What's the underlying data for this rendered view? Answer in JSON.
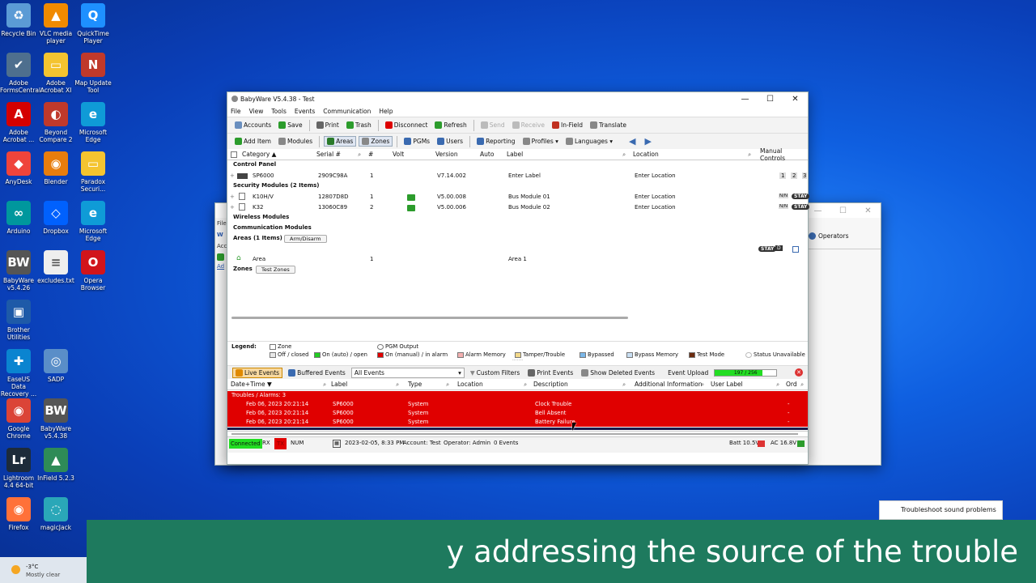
{
  "desktop": {
    "icons": [
      {
        "label": "Recycle Bin",
        "col": 0,
        "row": 0,
        "color": "#5b9bd5",
        "glyph": "♻"
      },
      {
        "label": "VLC media player",
        "col": 1,
        "row": 0,
        "color": "#f08a00",
        "glyph": "▲"
      },
      {
        "label": "QuickTime Player",
        "col": 2,
        "row": 0,
        "color": "#1e90ff",
        "glyph": "Q"
      },
      {
        "label": "Adobe FormsCentral",
        "col": 0,
        "row": 1,
        "color": "#4e6f8e",
        "glyph": "✔"
      },
      {
        "label": "Adobe Acrobat XI",
        "col": 1,
        "row": 1,
        "color": "#f4c430",
        "glyph": "▭"
      },
      {
        "label": "Map Update Tool",
        "col": 2,
        "row": 1,
        "color": "#c0392b",
        "glyph": "N"
      },
      {
        "label": "Adobe Acrobat ...",
        "col": 0,
        "row": 2,
        "color": "#d40000",
        "glyph": "A"
      },
      {
        "label": "Beyond Compare 2",
        "col": 1,
        "row": 2,
        "color": "#c0392b",
        "glyph": "◐"
      },
      {
        "label": "Microsoft Edge",
        "col": 2,
        "row": 2,
        "color": "#0f9bd7",
        "glyph": "e"
      },
      {
        "label": "AnyDesk",
        "col": 0,
        "row": 3,
        "color": "#ef443b",
        "glyph": "◆"
      },
      {
        "label": "Blender",
        "col": 1,
        "row": 3,
        "color": "#e87d0d",
        "glyph": "◉"
      },
      {
        "label": "Paradox Securi...",
        "col": 2,
        "row": 3,
        "color": "#f4c430",
        "glyph": "▭"
      },
      {
        "label": "Arduino",
        "col": 0,
        "row": 4,
        "color": "#00979d",
        "glyph": "∞"
      },
      {
        "label": "Dropbox",
        "col": 1,
        "row": 4,
        "color": "#0061fe",
        "glyph": "◇"
      },
      {
        "label": "Microsoft Edge",
        "col": 2,
        "row": 4,
        "color": "#0f9bd7",
        "glyph": "e"
      },
      {
        "label": "BabyWare v5.4.26",
        "col": 0,
        "row": 5,
        "color": "#555",
        "glyph": "BW"
      },
      {
        "label": "excludes.txt",
        "col": 1,
        "row": 5,
        "color": "#eee",
        "glyph": "≡"
      },
      {
        "label": "Opera Browser",
        "col": 2,
        "row": 5,
        "color": "#d1141b",
        "glyph": "O"
      },
      {
        "label": "Brother Utilities",
        "col": 0,
        "row": 6,
        "color": "#1e5aa8",
        "glyph": "▣"
      },
      {
        "label": "EaseUS Data Recovery ...",
        "col": 0,
        "row": 7,
        "color": "#0a84d0",
        "glyph": "✚"
      },
      {
        "label": "SADP",
        "col": 1,
        "row": 7,
        "color": "#5a8ec8",
        "glyph": "◎"
      },
      {
        "label": "Google Chrome",
        "col": 0,
        "row": 8,
        "color": "#db4437",
        "glyph": "◉"
      },
      {
        "label": "BabyWare v5.4.38",
        "col": 1,
        "row": 8,
        "color": "#555",
        "glyph": "BW"
      },
      {
        "label": "Lightroom 4.4 64-bit",
        "col": 0,
        "row": 9,
        "color": "#1d2b3a",
        "glyph": "Lr"
      },
      {
        "label": "InField 5.2.3",
        "col": 1,
        "row": 9,
        "color": "#2e8b57",
        "glyph": "▲"
      },
      {
        "label": "Firefox",
        "col": 0,
        "row": 10,
        "color": "#ff7139",
        "glyph": "◉"
      },
      {
        "label": "magicJack",
        "col": 1,
        "row": 10,
        "color": "#2aa7b8",
        "glyph": "◌"
      }
    ]
  },
  "weather": {
    "temp": "-3°C",
    "cond": "Mostly clear"
  },
  "tooltip": "Troubleshoot sound problems",
  "caption": "y addressing the source of the trouble",
  "bgwin": {
    "toolbar_item": "Operators",
    "sidebar": [
      "File",
      "W",
      "Acc",
      "Ad"
    ]
  },
  "app": {
    "title": "BabyWare V5.4.38 - Test",
    "menu": [
      "File",
      "View",
      "Tools",
      "Events",
      "Communication",
      "Help"
    ],
    "toolbar1": [
      {
        "label": "Accounts",
        "color": "#6a8fbf"
      },
      {
        "label": "Save",
        "color": "#2c9c2c"
      },
      {
        "label": "Print",
        "color": "#666"
      },
      {
        "label": "Trash",
        "color": "#2c9c2c"
      },
      {
        "label": "Disconnect",
        "color": "#d00"
      },
      {
        "label": "Refresh",
        "color": "#2c9c2c"
      },
      {
        "label": "Send",
        "color": "#bbb",
        "dis": true
      },
      {
        "label": "Receive",
        "color": "#bbb",
        "dis": true
      },
      {
        "label": "In-Field",
        "color": "#c03020"
      },
      {
        "label": "Translate",
        "color": "#888"
      }
    ],
    "toolbar2": [
      {
        "label": "Add Item",
        "color": "#2c9c2c"
      },
      {
        "label": "Modules",
        "color": "#888"
      },
      {
        "label": "Areas",
        "color": "#2a7a2a",
        "sel": true
      },
      {
        "label": "Zones",
        "color": "#888",
        "sel": true
      },
      {
        "label": "PGMs",
        "color": "#3a6ab0"
      },
      {
        "label": "Users",
        "color": "#3a6ab0"
      },
      {
        "label": "Reporting",
        "color": "#3a6ab0"
      },
      {
        "label": "Profiles ▾",
        "color": "#888"
      },
      {
        "label": "Languages ▾",
        "color": "#888"
      }
    ],
    "columns": [
      "Category ▲",
      "Serial #",
      "#",
      "Volt",
      "Version",
      "Auto",
      "Label",
      "Location",
      "Manual Controls"
    ],
    "sections": {
      "control_panel": "Control Panel",
      "security_modules": "Security Modules (2 Items)",
      "wireless": "Wireless Modules",
      "communication": "Communication Modules",
      "areas": "Areas (1 Items)",
      "arm_disarm": "Arm/Disarm",
      "zones": "Zones",
      "test_zones": "Test Zones"
    },
    "panel_row": {
      "name": "SP6000",
      "serial": "2909C98A",
      "num": "1",
      "version": "V7.14.002",
      "label": "Enter Label",
      "location": "Enter Location",
      "controls": [
        "1",
        "2",
        "3"
      ]
    },
    "modules": [
      {
        "name": "K10H/V",
        "serial": "12807D8D",
        "num": "1",
        "version": "V5.00.008",
        "label": "Bus Module 01",
        "location": "Enter Location",
        "nn": "N/N",
        "stay": "STAY"
      },
      {
        "name": "K32",
        "serial": "13060C89",
        "num": "2",
        "version": "V5.00.006",
        "label": "Bus Module 02",
        "location": "Enter Location",
        "nn": "N/N",
        "stay": "STAY"
      }
    ],
    "area_row": {
      "name": "Area",
      "num": "1",
      "label": "Area 1",
      "stay": "STAY",
      "d": "D"
    },
    "legend": {
      "title": "Legend:",
      "zone": "Zone",
      "pgm": "PGM Output",
      "items": [
        {
          "label": "Off / closed",
          "color": "#e8e8e8"
        },
        {
          "label": "On (auto) / open",
          "color": "#22cc22"
        },
        {
          "label": "On (manual) / in alarm",
          "color": "#e00000"
        },
        {
          "label": "Alarm Memory",
          "color": "#f3b0b0"
        },
        {
          "label": "Tamper/Trouble",
          "color": "#f3d98a"
        },
        {
          "label": "Bypassed",
          "color": "#7bb7e8"
        },
        {
          "label": "Bypass Memory",
          "color": "#c8def2"
        },
        {
          "label": "Test Mode",
          "color": "#6b2b0f"
        },
        {
          "label": "Status Unavailable",
          "color": "#ffffff"
        }
      ]
    },
    "events_bar": {
      "live": "Live Events",
      "buffered": "Buffered Events",
      "filter": "All Events",
      "custom": "Custom Filters",
      "print": "Print Events",
      "deleted": "Show Deleted Events",
      "upload_label": "Event Upload",
      "upload_text": "197 / 256",
      "upload_fraction": 0.77
    },
    "event_columns": [
      "Date+Time ▼",
      "Label",
      "Type",
      "Location",
      "Description",
      "Additional Information",
      "User Label",
      "Ord"
    ],
    "event_group": "Troubles / Alarms: 3",
    "events": [
      {
        "datetime": "Feb 06, 2023  20:21:14",
        "label": "SP6000",
        "type": "System",
        "description": "Clock Trouble",
        "ord": "-"
      },
      {
        "datetime": "Feb 06, 2023  20:21:14",
        "label": "SP6000",
        "type": "System",
        "description": "Bell Absent",
        "ord": "-"
      },
      {
        "datetime": "Feb 06, 2023  20:21:14",
        "label": "SP6000",
        "type": "System",
        "description": "Battery Failure",
        "ord": "-"
      }
    ],
    "status": {
      "connected": "Connected",
      "rx": "RX",
      "tx": "TX",
      "num": "NUM",
      "datetime": "2023-02-05, 8:33 PM",
      "account": "Account: Test",
      "operator": "Operator: Admin",
      "events": "0 Events",
      "batt": "Batt 10.5V",
      "ac": "AC 16.8V"
    }
  }
}
